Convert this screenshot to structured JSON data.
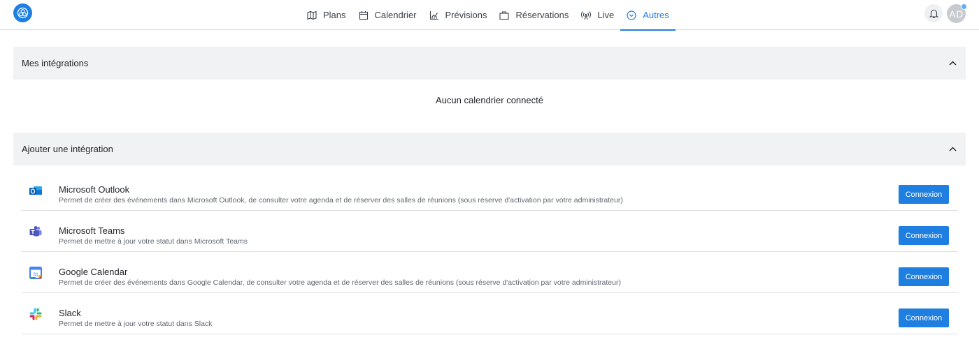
{
  "nav": {
    "items": [
      {
        "label": "Plans",
        "icon": "map-icon"
      },
      {
        "label": "Calendrier",
        "icon": "calendar-icon"
      },
      {
        "label": "Prévisions",
        "icon": "chart-icon"
      },
      {
        "label": "Réservations",
        "icon": "briefcase-icon"
      },
      {
        "label": "Live",
        "icon": "broadcast-icon"
      },
      {
        "label": "Autres",
        "icon": "chevron-circle-icon",
        "active": true
      }
    ]
  },
  "user": {
    "initials": "AD"
  },
  "colors": {
    "accent": "#1f7fe0",
    "panel_bg": "#f1f2f3",
    "notification_dot": "#5aaeff"
  },
  "my_integrations": {
    "title": "Mes intégrations",
    "empty_message": "Aucun calendrier connecté"
  },
  "add_integration": {
    "title": "Ajouter une intégration",
    "items": [
      {
        "name": "Microsoft Outlook",
        "icon": "outlook-icon",
        "description": "Permet de créer des événements dans Microsoft Outlook, de consulter votre agenda et de réserver des salles de réunions (sous réserve d'activation par votre administrateur)",
        "button": "Connexion"
      },
      {
        "name": "Microsoft Teams",
        "icon": "teams-icon",
        "description": "Permet de mettre à jour votre statut dans Microsoft Teams",
        "button": "Connexion"
      },
      {
        "name": "Google Calendar",
        "icon": "google-calendar-icon",
        "description": "Permet de créer des événements dans Google Calendar, de consulter votre agenda et de réserver des salles de réunions (sous réserve d'activation par votre administrateur)",
        "button": "Connexion"
      },
      {
        "name": "Slack",
        "icon": "slack-icon",
        "description": "Permet de mettre à jour votre statut dans Slack",
        "button": "Connexion"
      }
    ]
  }
}
